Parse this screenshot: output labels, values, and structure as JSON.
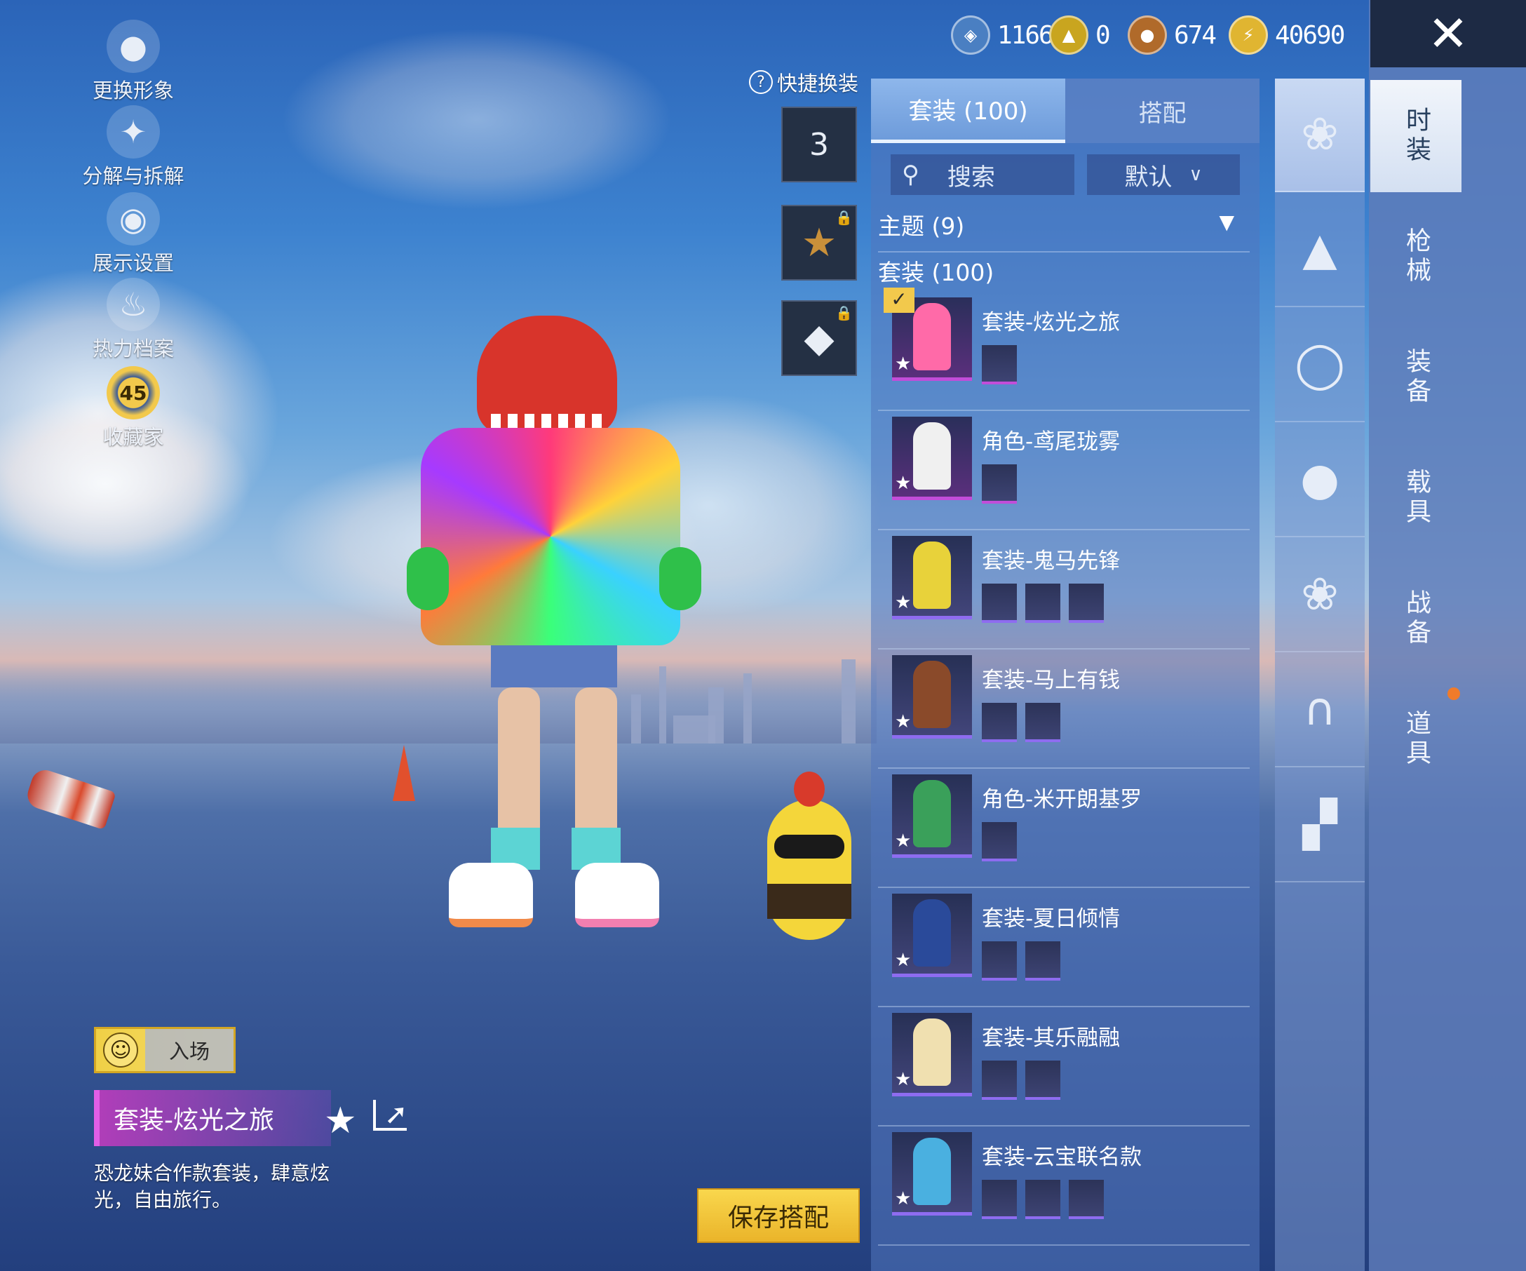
{
  "left_menu": [
    {
      "label": "更换形象",
      "icon": "user-silhouette-icon"
    },
    {
      "label": "分解与拆解",
      "icon": "puzzle-icon"
    },
    {
      "label": "展示设置",
      "icon": "eye-icon"
    },
    {
      "label": "热力档案",
      "icon": "flame-icon"
    },
    {
      "label": "收藏家",
      "icon": "collector-badge-icon",
      "badge": "45"
    }
  ],
  "currencies": [
    {
      "icon": "silver-coin-icon",
      "value": "1166",
      "color": "#4a7fc2"
    },
    {
      "icon": "ag-coin-icon",
      "value": "0",
      "color": "#c9a51f"
    },
    {
      "icon": "bronze-coin-icon",
      "value": "674",
      "color": "#b06a2a"
    },
    {
      "icon": "bp-coin-icon",
      "value": "40690",
      "color": "#e0b531"
    }
  ],
  "quick_change": {
    "label": "快捷换装",
    "slot_number": "3"
  },
  "tabs": {
    "outfit": "套装 (100)",
    "match": "搭配"
  },
  "search": {
    "placeholder": "搜索",
    "sort": "默认"
  },
  "sections": {
    "theme": "主题 (9)",
    "outfits": "套装 (100)"
  },
  "items": [
    {
      "name": "套装-炫光之旅",
      "equipped": true,
      "rarity": "pink",
      "minis": 1
    },
    {
      "name": "角色-鸢尾珑雾",
      "equipped": false,
      "rarity": "pink",
      "minis": 1
    },
    {
      "name": "套装-鬼马先锋",
      "equipped": false,
      "rarity": "blue",
      "minis": 3
    },
    {
      "name": "套装-马上有钱",
      "equipped": false,
      "rarity": "blue",
      "minis": 2
    },
    {
      "name": "角色-米开朗基罗",
      "equipped": false,
      "rarity": "blue",
      "minis": 1
    },
    {
      "name": "套装-夏日倾情",
      "equipped": false,
      "rarity": "blue",
      "minis": 2
    },
    {
      "name": "套装-其乐融融",
      "equipped": false,
      "rarity": "blue",
      "minis": 2
    },
    {
      "name": "套装-云宝联名款",
      "equipped": false,
      "rarity": "blue",
      "minis": 3
    }
  ],
  "categories": [
    {
      "icon": "outfit-set-icon"
    },
    {
      "icon": "cap-icon"
    },
    {
      "icon": "glasses-icon"
    },
    {
      "icon": "mask-icon"
    },
    {
      "icon": "outfit-set-icon"
    },
    {
      "icon": "pants-icon"
    },
    {
      "icon": "boots-icon"
    }
  ],
  "main_tabs": [
    "时装",
    "枪械",
    "装备",
    "载具",
    "战备",
    "道具"
  ],
  "preview": {
    "emote_label": "入场",
    "title": "套装-炫光之旅",
    "description": "恐龙妹合作款套装，肆意炫光，自由旅行。"
  },
  "save_button": "保存搭配",
  "accent_colors": {
    "gold": "#f2c94c",
    "pink": "#c24dd9",
    "blue": "#8e6cf0",
    "notify": "#f07b2a"
  }
}
